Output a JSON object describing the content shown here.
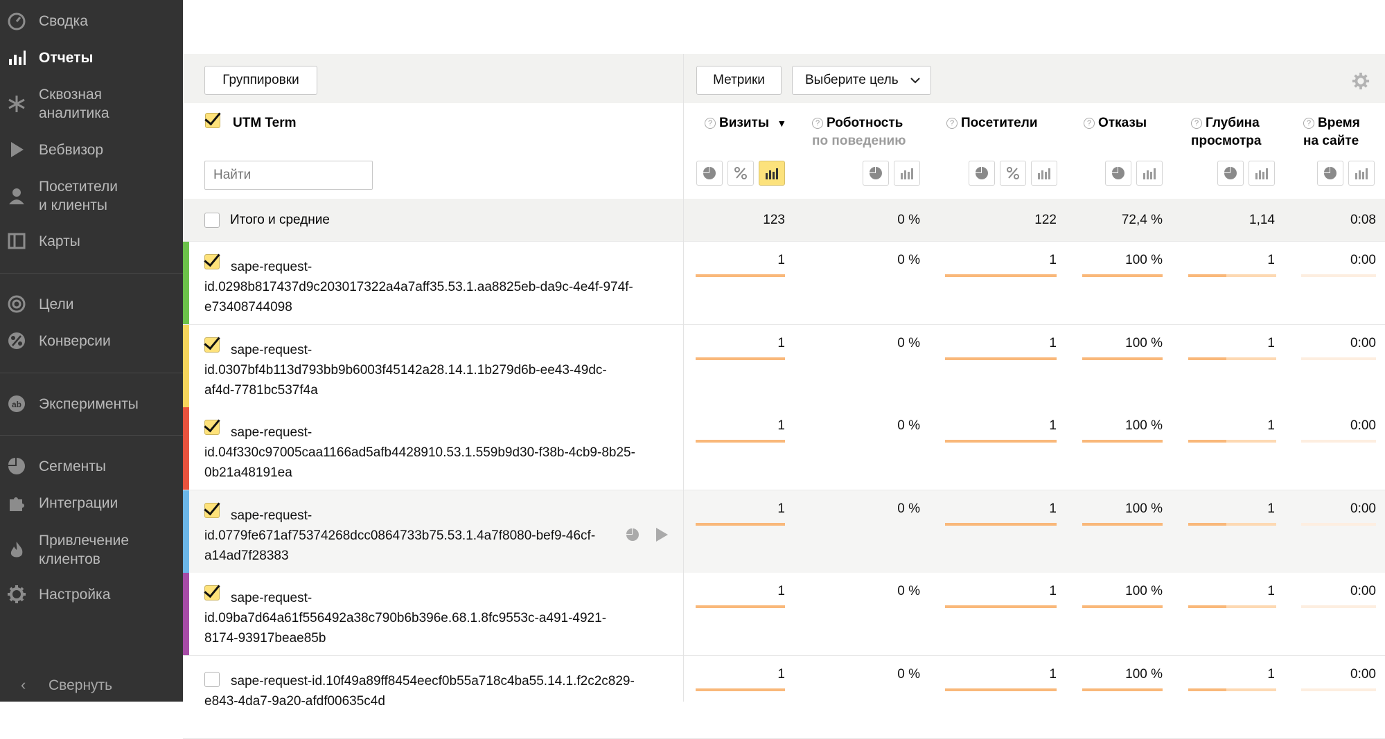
{
  "sidebar": {
    "items": [
      {
        "label": "Сводка",
        "icon": "gauge-icon"
      },
      {
        "label": "Отчеты",
        "icon": "bar-chart-icon",
        "active": true
      },
      {
        "label": "Сквозная\nаналитика",
        "icon": "snowflake-icon"
      },
      {
        "label": "Вебвизор",
        "icon": "play-icon"
      },
      {
        "label": "Посетители\nи клиенты",
        "icon": "person-icon"
      },
      {
        "label": "Карты",
        "icon": "map-icon"
      },
      {
        "label": "Цели",
        "icon": "target-icon"
      },
      {
        "label": "Конверсии",
        "icon": "percent-icon"
      },
      {
        "label": "Эксперименты",
        "icon": "ab-icon"
      },
      {
        "label": "Сегменты",
        "icon": "pie-icon"
      },
      {
        "label": "Интеграции",
        "icon": "puzzle-icon"
      },
      {
        "label": "Привлечение\nклиентов",
        "icon": "flame-icon"
      },
      {
        "label": "Настройка",
        "icon": "gear-icon"
      }
    ],
    "collapse_label": "Свернуть"
  },
  "toolbar": {
    "groupings_label": "Группировки",
    "metrics_label": "Метрики",
    "goal_label": "Выберите цель"
  },
  "dimension": {
    "title": "UTM Term",
    "search_placeholder": "Найти"
  },
  "columns": [
    {
      "title": "Визиты",
      "sort": "▼",
      "subtitle": ""
    },
    {
      "title": "Роботность",
      "subtitle": "по поведению"
    },
    {
      "title": "Посетители",
      "subtitle": ""
    },
    {
      "title": "Отказы",
      "subtitle": ""
    },
    {
      "title": "Глубина",
      "subtitle": "просмотра"
    },
    {
      "title": "Время",
      "subtitle": "на сайте"
    }
  ],
  "totals": {
    "label": "Итого и средние",
    "values": [
      "123",
      "0 %",
      "122",
      "72,4 %",
      "1,14",
      "0:08"
    ]
  },
  "rows": [
    {
      "line1": "sape-request-",
      "line2": "id.0298b817437d9c203017322a4a7aff35.53.1.aa8825eb-da9c-4e4f-974f-",
      "line3": "e73408744098",
      "values": [
        "1",
        "0 %",
        "1",
        "100 %",
        "1",
        "0:00"
      ],
      "color": "#6cc24a",
      "checked": true
    },
    {
      "line1": "sape-request-",
      "line2": "id.0307bf4b113d793bb9b6003f45142a28.14.1.1b279d6b-ee43-49dc-",
      "line3": "af4d-7781bc537f4a",
      "values": [
        "1",
        "0 %",
        "1",
        "100 %",
        "1",
        "0:00"
      ],
      "color": "#f6d55c",
      "checked": true
    },
    {
      "line1": "sape-request-",
      "line2": "id.04f330c97005caa1166ad5afb4428910.53.1.559b9d30-f38b-4cb9-8b25-",
      "line3": "0b21a48191ea",
      "values": [
        "1",
        "0 %",
        "1",
        "100 %",
        "1",
        "0:00"
      ],
      "color": "#e8533e",
      "checked": true
    },
    {
      "line1": "sape-request-",
      "line2": "id.0779fe671af75374268dcc0864733b75.53.1.4a7f8080-bef9-46cf-",
      "line3": "a14ad7f28383",
      "values": [
        "1",
        "0 %",
        "1",
        "100 %",
        "1",
        "0:00"
      ],
      "color": "#6bb6e8",
      "checked": true
    },
    {
      "line1": "sape-request-",
      "line2": "id.09ba7d64a61f556492a38c790b6b396e.68.1.8fc9553c-a491-4921-",
      "line3": "8174-93917beae85b",
      "values": [
        "1",
        "0 %",
        "1",
        "100 %",
        "1",
        "0:00"
      ],
      "color": "#a64ca6",
      "checked": true
    },
    {
      "line1": "sape-request-id.10f49a89ff8454eecf0b55a718c4ba55.14.1.f2c2c829-",
      "line2": "e843-4da7-9a20-afdf00635c4d",
      "line3": "",
      "values": [
        "1",
        "0 %",
        "1",
        "100 %",
        "1",
        "0:00"
      ],
      "color": "",
      "checked": false
    }
  ]
}
